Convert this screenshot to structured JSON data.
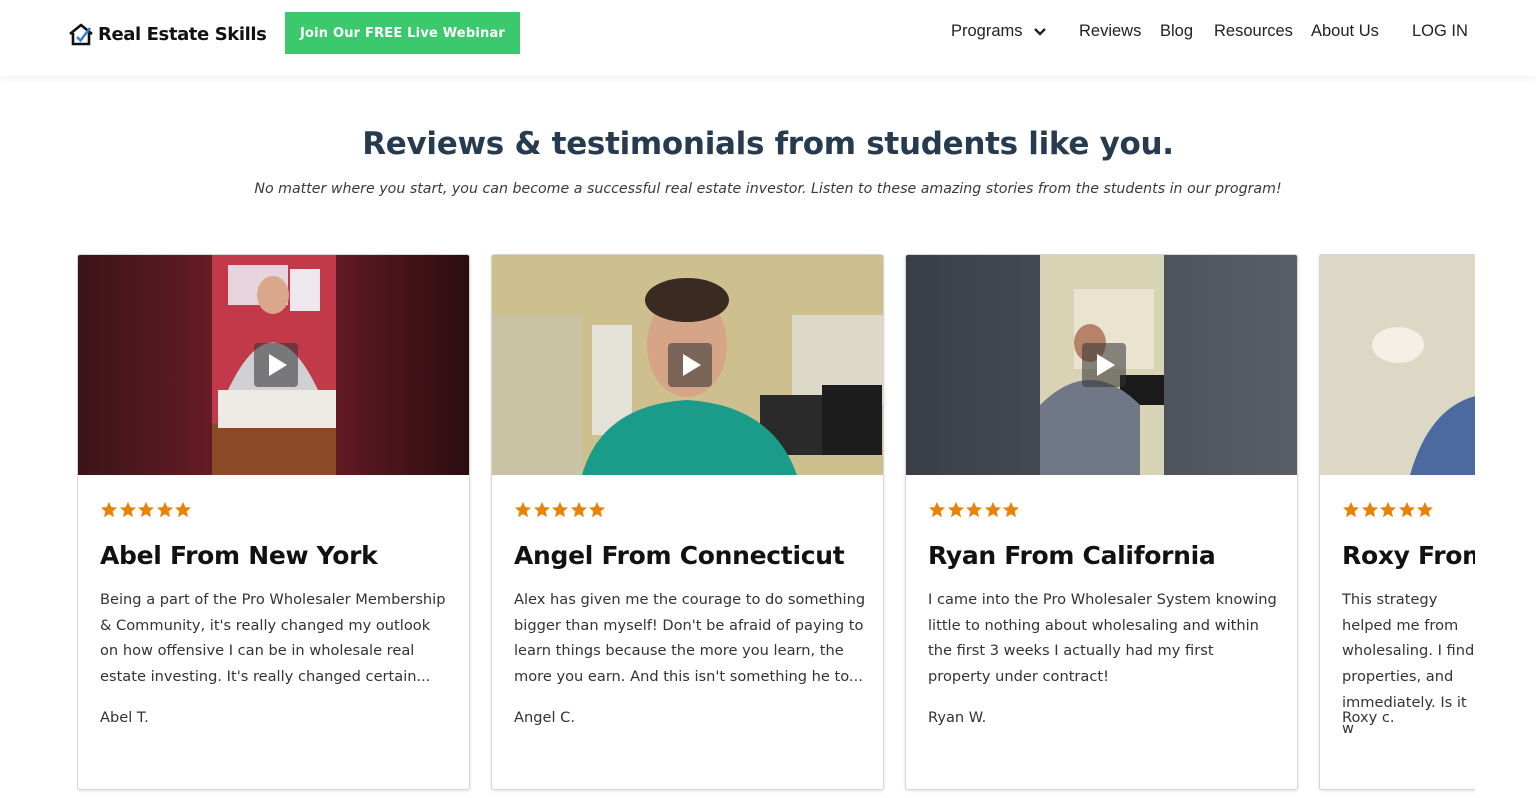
{
  "header": {
    "logo_text": "Real Estate Skills",
    "webinar_button": "Join Our FREE Live Webinar",
    "nav": [
      {
        "label": "Programs"
      },
      {
        "label": "Reviews"
      },
      {
        "label": "Blog"
      },
      {
        "label": "Resources"
      },
      {
        "label": "About Us"
      },
      {
        "label": "LOG IN"
      }
    ]
  },
  "section": {
    "title": "Reviews & testimonials from students like you.",
    "subtitle": "No matter where you start, you can become a successful real estate investor. Listen to these amazing stories from the students in our program!"
  },
  "colors": {
    "accent_green": "#3cc86d",
    "title_navy": "#263b50",
    "star_orange": "#e8830a"
  },
  "reviews": [
    {
      "title": "Abel From New York",
      "text": "Being a part of the Pro Wholesaler Membership & Community, it's really changed my outlook on how offensive I can be in wholesale real estate investing. It's really changed certain...",
      "author": "Abel T.",
      "rating": 5
    },
    {
      "title": "Angel From Connecticut",
      "text": "Alex has given me the courage to do something bigger than myself! Don't be afraid of paying to learn things because the more you learn, the more you earn. And this isn't something he to...",
      "author": "Angel C.",
      "rating": 5
    },
    {
      "title": "Ryan From California",
      "text": "I came into the Pro Wholesaler System knowing little to nothing about wholesaling and within the first 3 weeks I actually had my first property under contract!",
      "author": "Ryan W.",
      "rating": 5
    },
    {
      "title": "Roxy From",
      "text": "This strategy helped me from wholesaling. I find properties, and immediately. Is it w",
      "author": "Roxy c.",
      "rating": 5
    }
  ]
}
